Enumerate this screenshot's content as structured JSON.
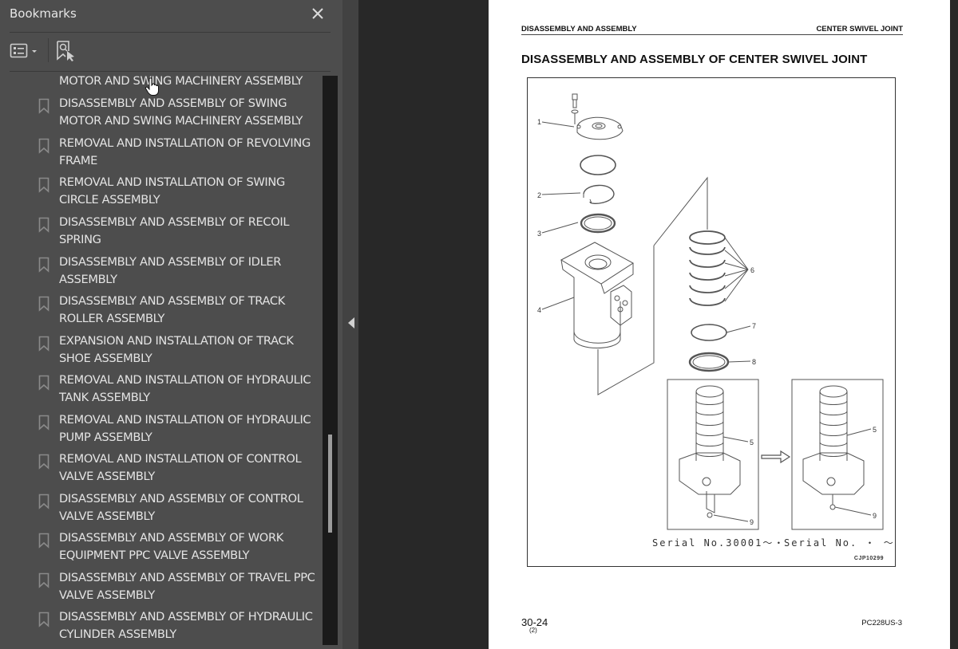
{
  "sidebar": {
    "title": "Bookmarks",
    "close_icon": "close-icon",
    "toolbar": {
      "options_icon": "list-options-icon",
      "find_icon": "find-current-bookmark-icon"
    },
    "items": [
      {
        "label": "MOTOR AND SWING MACHINERY ASSEMBLY",
        "partial": true
      },
      {
        "label": "DISASSEMBLY AND ASSEMBLY OF SWING MOTOR AND SWING MACHINERY ASSEMBLY"
      },
      {
        "label": "REMOVAL AND INSTALLATION OF REVOLVING FRAME"
      },
      {
        "label": "REMOVAL AND INSTALLATION OF SWING CIRCLE ASSEMBLY"
      },
      {
        "label": "DISASSEMBLY AND ASSEMBLY OF RECOIL SPRING"
      },
      {
        "label": "DISASSEMBLY AND ASSEMBLY OF IDLER ASSEMBLY"
      },
      {
        "label": "DISASSEMBLY AND ASSEMBLY OF TRACK ROLLER ASSEMBLY"
      },
      {
        "label": "EXPANSION AND INSTALLATION OF TRACK SHOE ASSEMBLY"
      },
      {
        "label": "REMOVAL AND INSTALLATION OF HYDRAULIC TANK ASSEMBLY"
      },
      {
        "label": "REMOVAL AND INSTALLATION OF HYDRAULIC PUMP ASSEMBLY"
      },
      {
        "label": "REMOVAL AND INSTALLATION OF CONTROL VALVE ASSEMBLY"
      },
      {
        "label": "DISASSEMBLY AND ASSEMBLY OF CONTROL VALVE ASSEMBLY"
      },
      {
        "label": "DISASSEMBLY AND ASSEMBLY OF WORK EQUIPMENT PPC VALVE ASSEMBLY"
      },
      {
        "label": "DISASSEMBLY AND ASSEMBLY OF TRAVEL PPC VALVE ASSEMBLY"
      },
      {
        "label": "DISASSEMBLY AND ASSEMBLY OF HYDRAULIC CYLINDER ASSEMBLY"
      }
    ],
    "scroll_position_fraction": 0.63
  },
  "divider": {
    "collapse_icon": "collapse-left-icon"
  },
  "page": {
    "header_left": "DISASSEMBLY AND ASSEMBLY",
    "header_right": "CENTER SWIVEL JOINT",
    "title": "DISASSEMBLY AND ASSEMBLY OF CENTER SWIVEL JOINT",
    "figure": {
      "callouts": [
        "1",
        "2",
        "3",
        "4",
        "5",
        "6",
        "7",
        "8",
        "9",
        "5",
        "9"
      ],
      "serial_left": "Serial No.30001〜・",
      "serial_right": "Serial No.  ・  〜",
      "code": "CJP10299"
    },
    "page_number": "30-24",
    "revision": "(2)",
    "model": "PC228US-3"
  },
  "colors": {
    "sidebar_bg": "#4d4d4d",
    "viewer_bg": "#282828",
    "text_light": "#e4e4e4",
    "page_bg": "#ffffff"
  }
}
